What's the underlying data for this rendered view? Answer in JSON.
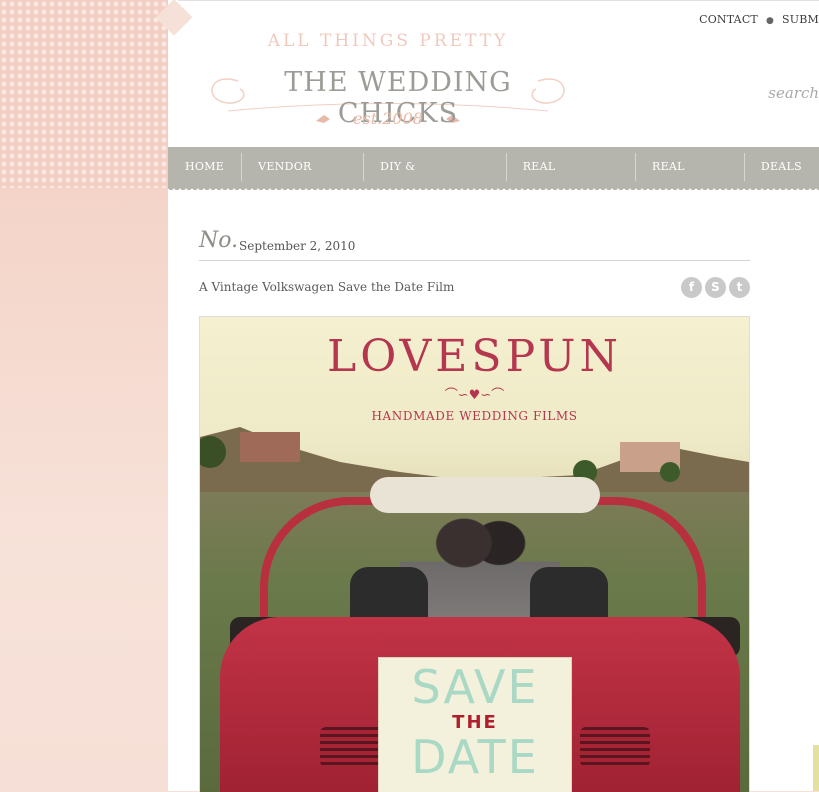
{
  "header": {
    "topnav": [
      "CONTACT",
      "SUBM"
    ],
    "logo": {
      "tagline": "ALL THINGS PRETTY",
      "brand": "THE WEDDING CHICKS",
      "est": "est.2008"
    },
    "search_label": "search"
  },
  "mainnav": [
    "HOME",
    "VENDOR GUIDE",
    "DIY & DOWNLOADS",
    "REAL WEDDINGS",
    "REAL BRIDES",
    "DEALS"
  ],
  "post": {
    "no_mark": "No.",
    "date": "September 2, 2010",
    "title": "A Vintage Volkswagen Save the Date Film",
    "share_icons": [
      "facebook-icon",
      "stumbleupon-icon",
      "twitter-icon"
    ]
  },
  "hero": {
    "brand": "LOVESPUN",
    "flourish": "⌒∽♥∽⌒",
    "subtitle": "HANDMADE WEDDING FILMS",
    "sign_save": "SAVE",
    "sign_the": "THE",
    "sign_date": "DATE"
  },
  "colors": {
    "nav_bg": "#b6b5ad",
    "accent_pink": "#f0c9bc",
    "lovespun_red": "#b5364f"
  }
}
